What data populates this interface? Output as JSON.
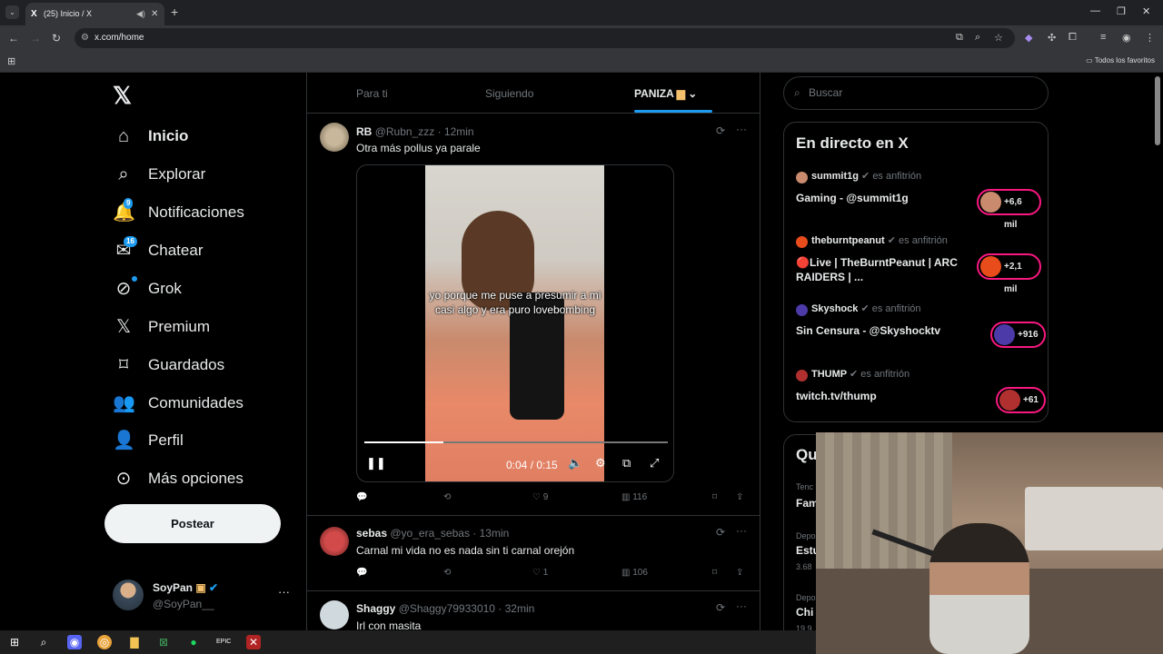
{
  "browser": {
    "tab_title": "(25) Inicio / X",
    "tab_favicon": "X",
    "url": "x.com/home",
    "bookmarks_label": "Todos los favoritos"
  },
  "nav": {
    "items": [
      {
        "label": "Inicio",
        "icon": "home-icon"
      },
      {
        "label": "Explorar",
        "icon": "search-icon"
      },
      {
        "label": "Notificaciones",
        "icon": "bell-icon",
        "badge": "9"
      },
      {
        "label": "Chatear",
        "icon": "mail-icon",
        "badge": "16"
      },
      {
        "label": "Grok",
        "icon": "grok-icon"
      },
      {
        "label": "Premium",
        "icon": "x-icon"
      },
      {
        "label": "Guardados",
        "icon": "bookmark-icon"
      },
      {
        "label": "Comunidades",
        "icon": "people-icon"
      },
      {
        "label": "Perfil",
        "icon": "person-icon"
      },
      {
        "label": "Más opciones",
        "icon": "more-circle-icon"
      }
    ],
    "post_button": "Postear",
    "profile": {
      "name": "SoyPan",
      "handle": "@SoyPan__"
    }
  },
  "feed": {
    "tabs": [
      "Para ti",
      "Siguiendo",
      "PANIZA"
    ],
    "active_tab": "PANIZA",
    "tweets": [
      {
        "name": "RB",
        "handle": "@Rubn_zzz · 12min",
        "text": "Otra más pollus ya parale",
        "video": {
          "caption": "yo porque me puse a presumir a mi casi algo y era puro lovebombing",
          "time": "0:04 / 0:15",
          "progress": 0.26
        },
        "likes": "9",
        "views": "116"
      },
      {
        "name": "sebas",
        "handle": "@yo_era_sebas · 13min",
        "text": "Carnal mi vida no es nada sin ti carnal orejón",
        "likes": "1",
        "views": "106"
      },
      {
        "name": "Shaggy",
        "handle": "@Shaggy79933010 · 32min",
        "text": "Irl con masita"
      }
    ]
  },
  "right": {
    "search_placeholder": "Buscar",
    "live_title": "En directo en X",
    "host_suffix": "es anfitrión",
    "live": [
      {
        "host": "summit1g",
        "title": "Gaming - @summit1g",
        "count": "+6,6 mil",
        "color": "#c98a6d"
      },
      {
        "host": "theburntpeanut",
        "title": "🔴Live | TheBurntPeanut | ARC RAIDERS | ...",
        "count": "+2,1 mil",
        "color": "#e74c1a"
      },
      {
        "host": "Skyshock",
        "title": "Sin Censura - @Skyshocktv",
        "count": "+916",
        "color": "#4b3aa8"
      },
      {
        "host": "THUMP",
        "title": "twitch.tv/thump",
        "count": "+61",
        "color": "#b03030"
      }
    ],
    "trends_title": "Qu",
    "trends": [
      {
        "cat": "Tenc",
        "name": "Fam"
      },
      {
        "cat": "Depo",
        "name": "Estu",
        "sub": "3.68"
      },
      {
        "cat": "Depo",
        "name": "Chi",
        "sub": "19.9"
      }
    ]
  }
}
